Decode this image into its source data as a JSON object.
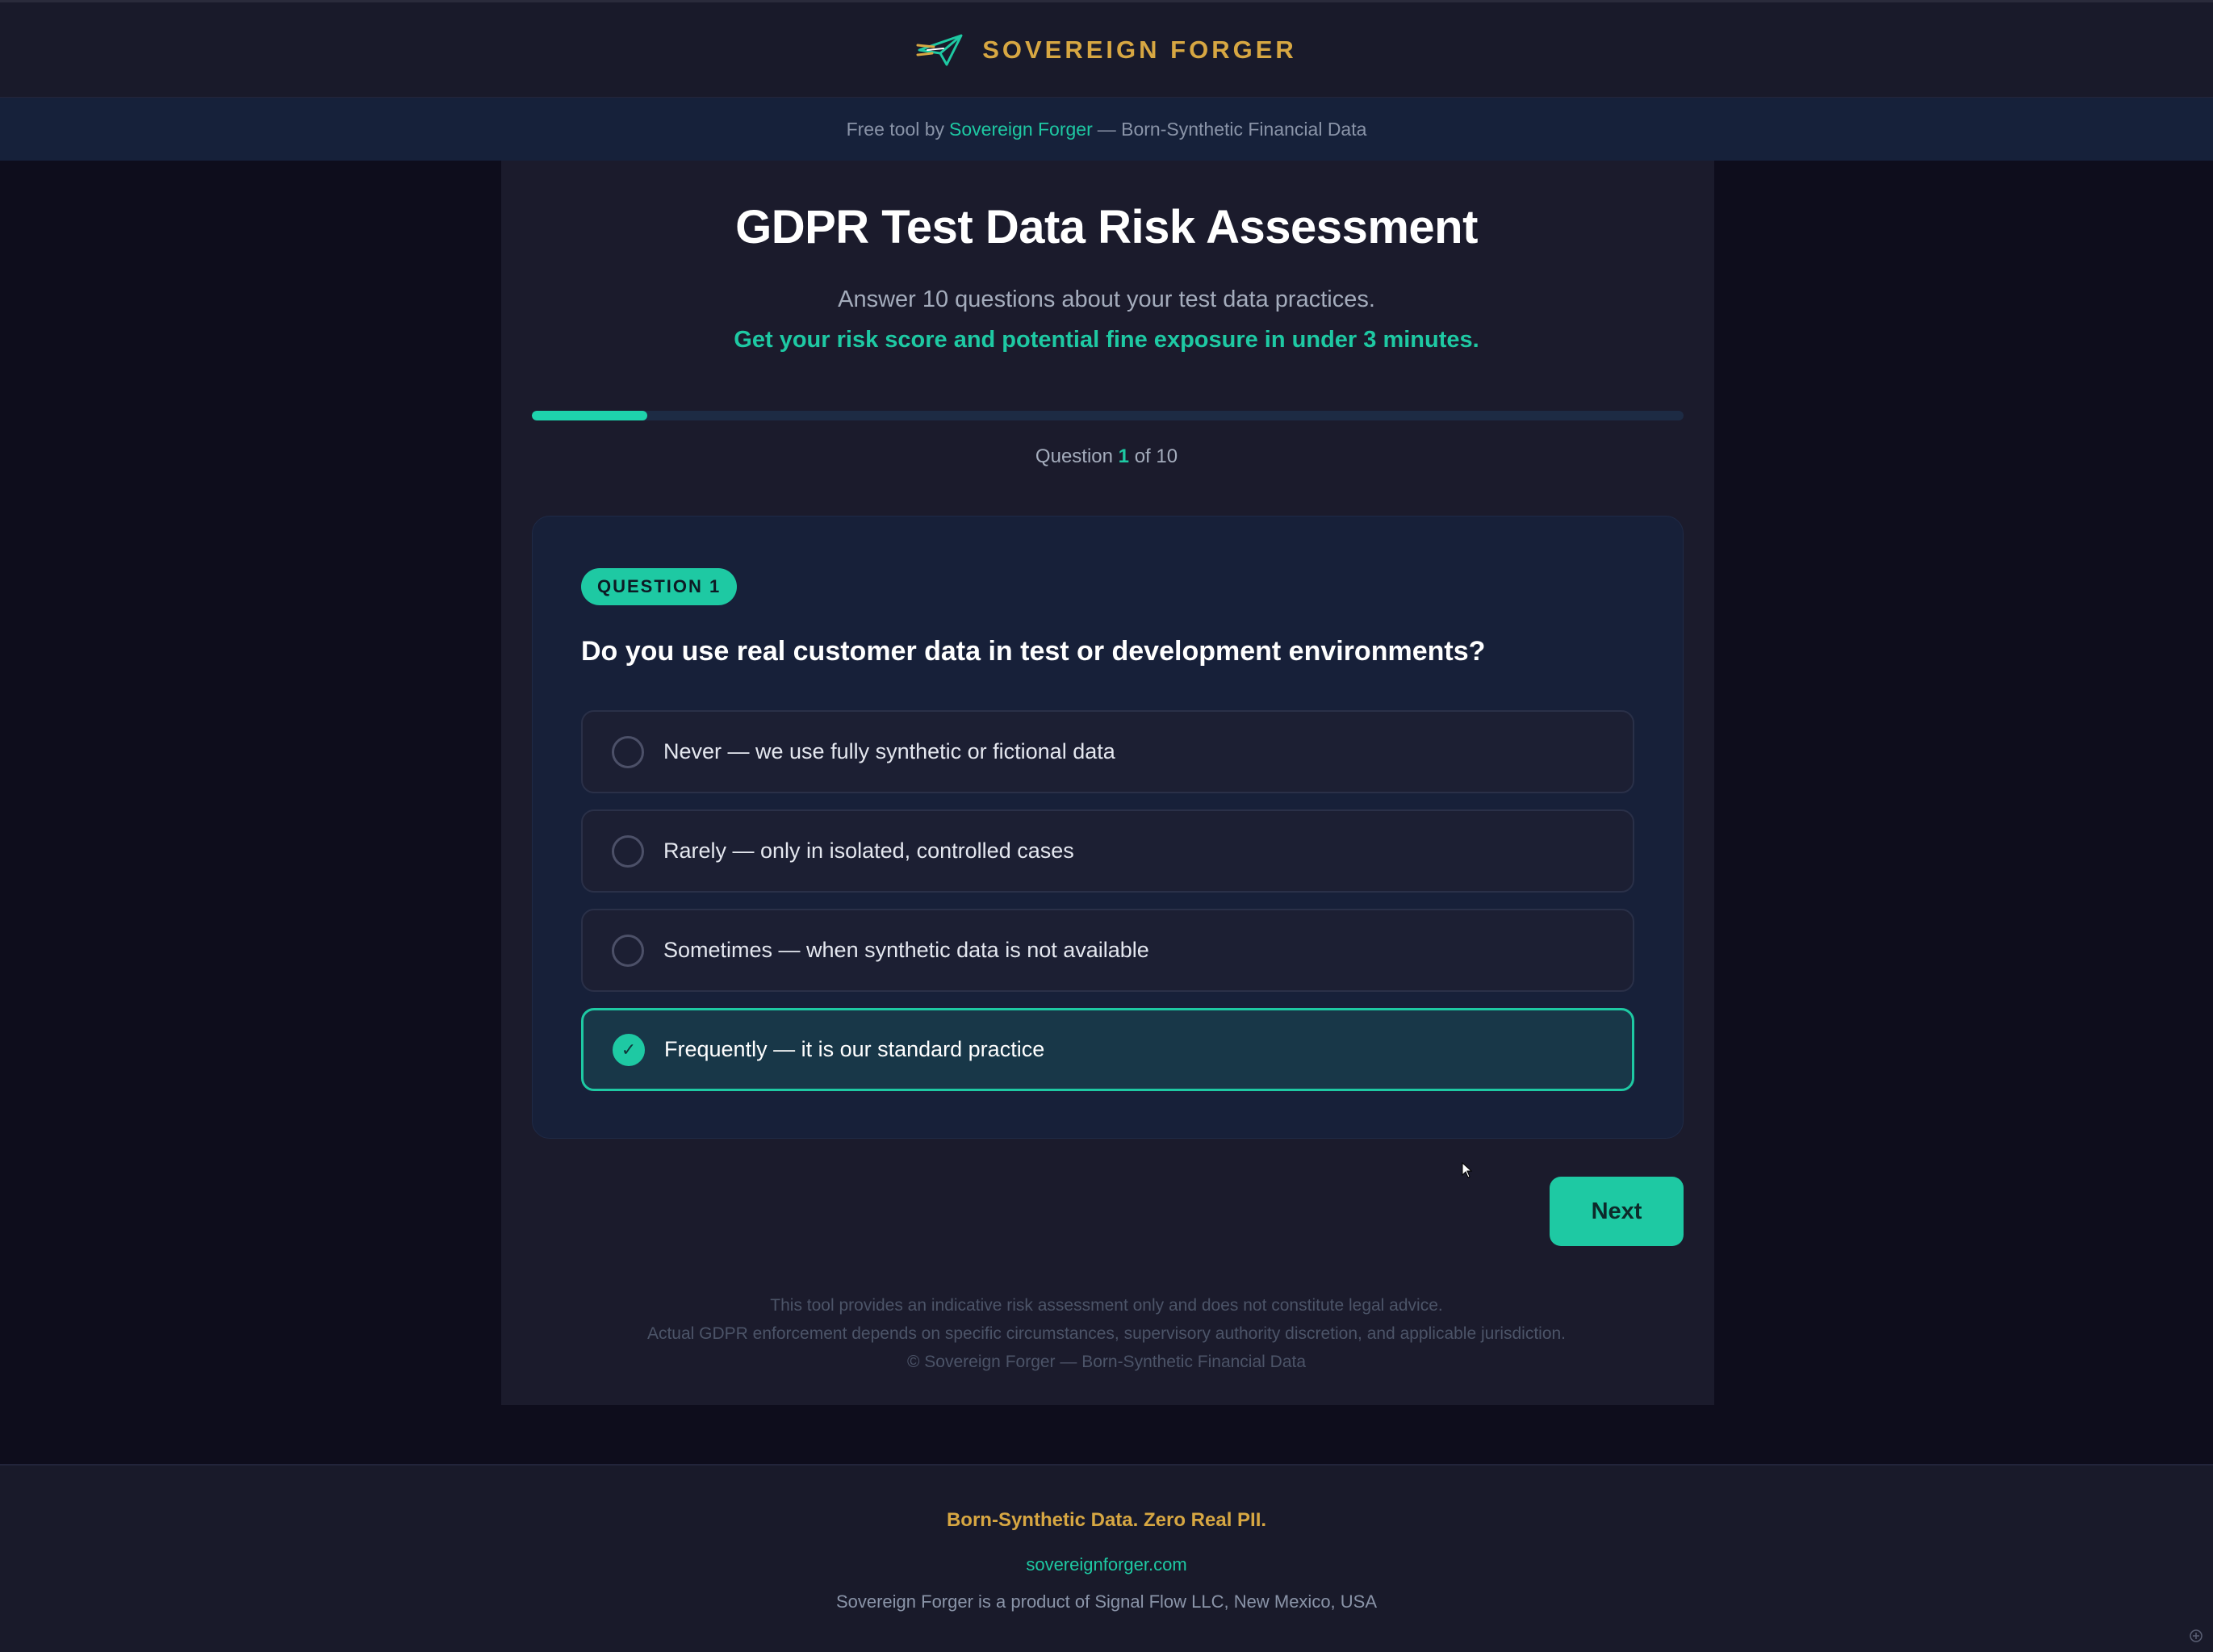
{
  "header": {
    "brand_name": "SOVEREIGN FORGER",
    "logo_icon": "paper-plane-forge-icon"
  },
  "subbar": {
    "prefix": "Free tool by",
    "link": "Sovereign Forger",
    "suffix": "— Born-Synthetic Financial Data"
  },
  "page": {
    "title": "GDPR Test Data Risk Assessment",
    "subtitle": "Answer 10 questions about your test data practices.",
    "subtitle_accent": "Get your risk score and potential fine exposure in under 3 minutes."
  },
  "progress": {
    "current": 1,
    "total": 10,
    "fraction": 0.1,
    "prefix": "Question",
    "current_label": "1",
    "suffix": "of 10"
  },
  "question": {
    "badge": "QUESTION 1",
    "text": "Do you use real customer data in test or development environments?",
    "options": [
      {
        "label": "Never — we use fully synthetic or fictional data",
        "selected": false
      },
      {
        "label": "Rarely — only in isolated, controlled cases",
        "selected": false
      },
      {
        "label": "Sometimes — when synthetic data is not available",
        "selected": false
      },
      {
        "label": "Frequently — it is our standard practice",
        "selected": true
      }
    ],
    "check_glyph": "✓"
  },
  "actions": {
    "next_label": "Next"
  },
  "disclaimer": {
    "line1": "This tool provides an indicative risk assessment only and does not constitute legal advice.",
    "line2": "Actual GDPR enforcement depends on specific circumstances, supervisory authority discretion, and applicable jurisdiction.",
    "line3": "© Sovereign Forger — Born-Synthetic Financial Data"
  },
  "footer": {
    "tagline": "Born-Synthetic Data. Zero Real PII.",
    "link": "sovereignforger.com",
    "company": "Sovereign Forger is a product of Signal Flow LLC, New Mexico, USA"
  },
  "colors": {
    "accent": "#1ec9a3",
    "brand_gold": "#d7a742",
    "background": "#0e0d1c",
    "panel": "#1b1b2c",
    "card": "#172039"
  }
}
